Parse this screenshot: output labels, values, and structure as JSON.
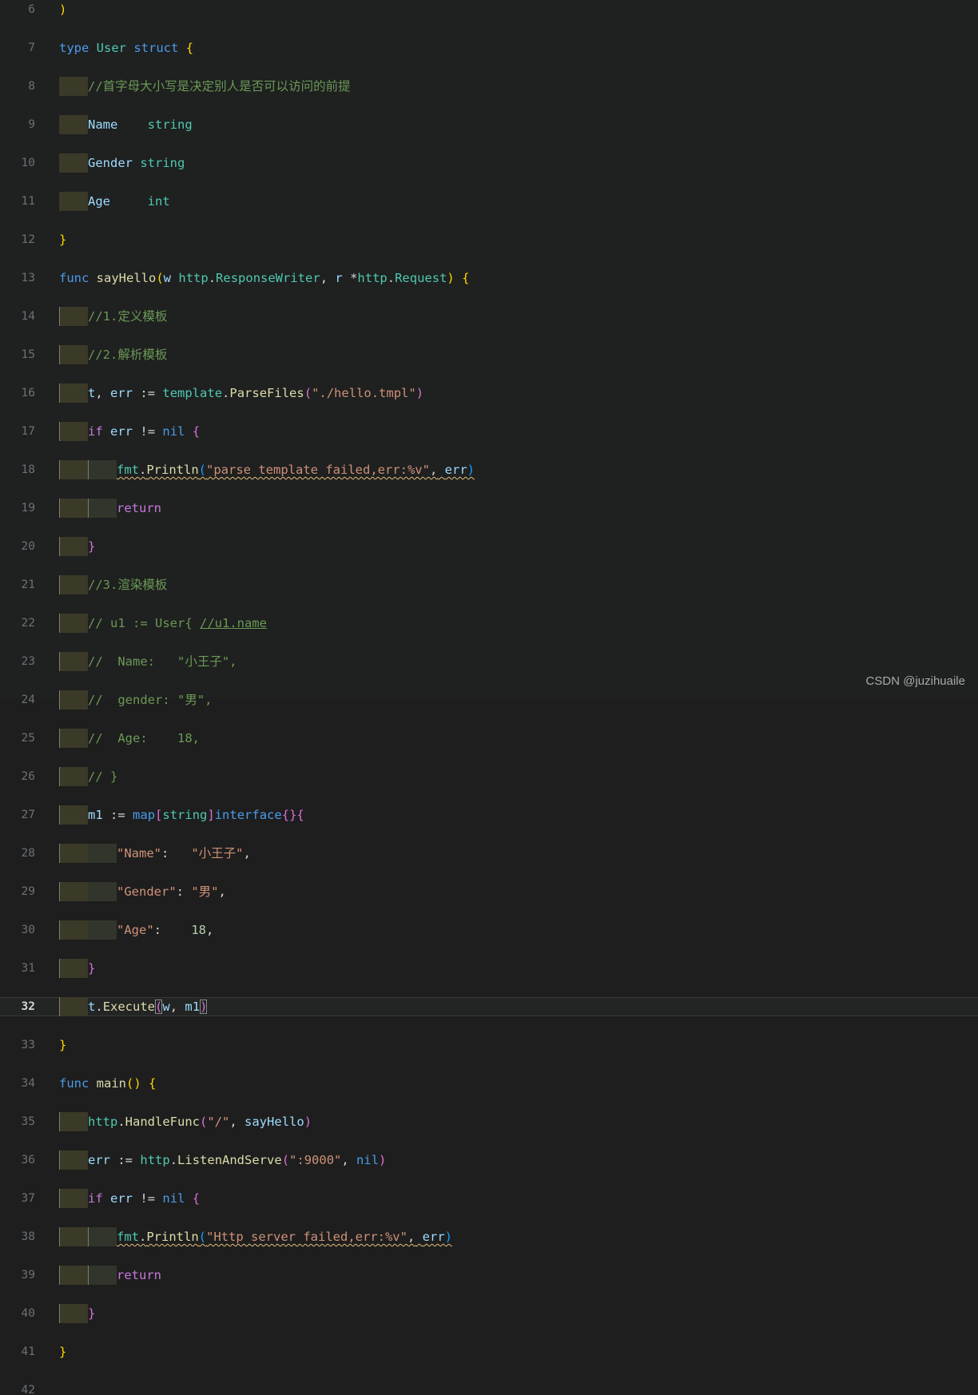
{
  "editor": {
    "language": "Go",
    "first_line_number": 6,
    "active_line_number": 32,
    "theme_colors": {
      "background": "#1f2020",
      "active_line_background": "#232424",
      "gutter_text": "#6b7177",
      "gutter_active_text": "#d2d5d8",
      "indent_guide_block": "#3b3a28",
      "indent_guide_line": "#7a7f72",
      "keyword_blue": "#4a9ceb",
      "keyword_magenta": "#c678dd",
      "type_teal": "#4ec9b0",
      "function_yellow": "#dcdcaa",
      "variable_lightblue": "#9cdcfe",
      "string_orange": "#ce9178",
      "number_green": "#b5cea8",
      "comment_green": "#6a9955",
      "bracket_yellow": "#ffd700",
      "bracket_magenta": "#da70d6",
      "bracket_blue": "#179fff",
      "error_squiggle": "#e5c07b"
    },
    "lines": [
      {
        "n": 6,
        "text": ")"
      },
      {
        "n": 7,
        "text": "type User struct {"
      },
      {
        "n": 8,
        "text": "    //首字母大小写是决定别人是否可以访问的前提"
      },
      {
        "n": 9,
        "text": "    Name    string"
      },
      {
        "n": 10,
        "text": "    Gender string"
      },
      {
        "n": 11,
        "text": "    Age     int"
      },
      {
        "n": 12,
        "text": "}"
      },
      {
        "n": 13,
        "text": "func sayHello(w http.ResponseWriter, r *http.Request) {"
      },
      {
        "n": 14,
        "text": "    //1.定义模板"
      },
      {
        "n": 15,
        "text": "    //2.解析模板"
      },
      {
        "n": 16,
        "text": "    t, err := template.ParseFiles(\"./hello.tmpl\")"
      },
      {
        "n": 17,
        "text": "    if err != nil {"
      },
      {
        "n": 18,
        "text": "        fmt.Println(\"parse template failed,err:%v\", err)"
      },
      {
        "n": 19,
        "text": "        return"
      },
      {
        "n": 20,
        "text": "    }"
      },
      {
        "n": 21,
        "text": "    //3.渲染模板"
      },
      {
        "n": 22,
        "text": "    // u1 := User{ //u1.name"
      },
      {
        "n": 23,
        "text": "    //  Name:   \"小王子\","
      },
      {
        "n": 24,
        "text": "    //  gender: \"男\","
      },
      {
        "n": 25,
        "text": "    //  Age:    18,"
      },
      {
        "n": 26,
        "text": "    // }"
      },
      {
        "n": 27,
        "text": "    m1 := map[string]interface{}{"
      },
      {
        "n": 28,
        "text": "        \"Name\":   \"小王子\","
      },
      {
        "n": 29,
        "text": "        \"Gender\": \"男\","
      },
      {
        "n": 30,
        "text": "        \"Age\":    18,"
      },
      {
        "n": 31,
        "text": "    }"
      },
      {
        "n": 32,
        "text": "    t.Execute(w, m1)"
      },
      {
        "n": 33,
        "text": "}"
      },
      {
        "n": 34,
        "text": "func main() {"
      },
      {
        "n": 35,
        "text": "    http.HandleFunc(\"/\", sayHello)"
      },
      {
        "n": 36,
        "text": "    err := http.ListenAndServe(\":9000\", nil)"
      },
      {
        "n": 37,
        "text": "    if err != nil {"
      },
      {
        "n": 38,
        "text": "        fmt.Println(\"Http server failed,err:%v\", err)"
      },
      {
        "n": 39,
        "text": "        return"
      },
      {
        "n": 40,
        "text": "    }"
      },
      {
        "n": 41,
        "text": "}"
      },
      {
        "n": 42,
        "text": ""
      }
    ],
    "line_numbers": {
      "l6": "6",
      "l7": "7",
      "l8": "8",
      "l9": "9",
      "l10": "10",
      "l11": "11",
      "l12": "12",
      "l13": "13",
      "l14": "14",
      "l15": "15",
      "l16": "16",
      "l17": "17",
      "l18": "18",
      "l19": "19",
      "l20": "20",
      "l21": "21",
      "l22": "22",
      "l23": "23",
      "l24": "24",
      "l25": "25",
      "l26": "26",
      "l27": "27",
      "l28": "28",
      "l29": "29",
      "l30": "30",
      "l31": "31",
      "l32": "32",
      "l33": "33",
      "l34": "34",
      "l35": "35",
      "l36": "36",
      "l37": "37",
      "l38": "38",
      "l39": "39",
      "l40": "40",
      "l41": "41",
      "l42": "42"
    },
    "tokens": {
      "paren_close": ")",
      "paren_open": "(",
      "brace_open": "{",
      "brace_close": "}",
      "bracket_open": "[",
      "bracket_close": "]",
      "kw_type": "type",
      "kw_struct": "struct",
      "kw_func": "func",
      "kw_if": "if",
      "kw_return": "return",
      "kw_map": "map",
      "kw_interface": "interface",
      "kw_nil": "nil",
      "id_user": "User",
      "id_name": "Name",
      "id_gender": "Gender",
      "id_age": "Age",
      "t_string": "string",
      "t_int": "int",
      "fn_sayhello": "sayHello",
      "fn_main": "main",
      "p_w": "w",
      "p_r": "r",
      "t_http": "http",
      "t_responsewriter": "ResponseWriter",
      "t_request": "Request",
      "v_t": "t",
      "v_err": "err",
      "v_m1": "m1",
      "v_u1": "u1",
      "ns_template": "template",
      "ns_fmt": "fmt",
      "m_parsefiles": "ParseFiles",
      "m_println": "Println",
      "m_execute": "Execute",
      "m_handlefunc": "HandleFunc",
      "m_listenandserve": "ListenAndServe",
      "op_assign_decl": ":=",
      "op_notequal": "!=",
      "op_comma": ",",
      "op_colon": ":",
      "op_dot": ".",
      "op_star": "*",
      "comment_8": "//首字母大小写是决定别人是否可以访问的前提",
      "comment_14": "//1.定义模板",
      "comment_15": "//2.解析模板",
      "comment_21": "//3.渲染模板",
      "comment_22_a": "// u1 := User{ ",
      "comment_22_b": "//u1.name",
      "comment_23": "//  Name:   \"小王子\",",
      "comment_24": "//  gender: \"男\",",
      "comment_25": "//  Age:    18,",
      "comment_26": "// }",
      "str_hellotmpl": "\"./hello.tmpl\"",
      "str_parsefail": "\"parse template failed,err:%v\"",
      "str_httpfail": "\"Http server failed,err:%v\"",
      "str_name_key": "\"Name\"",
      "str_gender_key": "\"Gender\"",
      "str_age_key": "\"Age\"",
      "str_xiaowangzi": "\"小王子\"",
      "str_nan": "\"男\"",
      "str_slash": "\"/\"",
      "str_port": "\":9000\"",
      "num_18": "18"
    }
  },
  "watermark": {
    "text": "CSDN @juzihuaile"
  }
}
